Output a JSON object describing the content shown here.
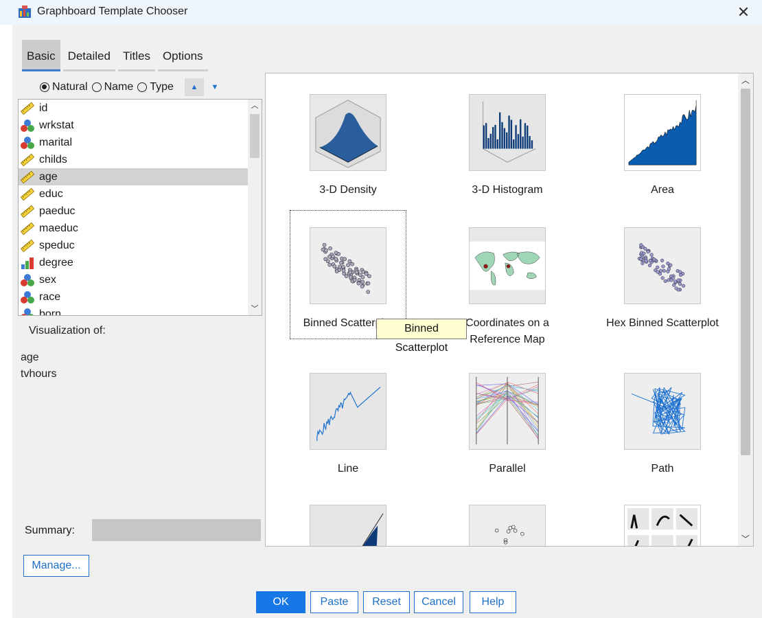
{
  "window": {
    "title": "Graphboard Template Chooser",
    "close_glyph": "✕",
    "icon": "graphboard-app-icon"
  },
  "tabs": [
    {
      "label": "Basic",
      "active": true
    },
    {
      "label": "Detailed",
      "active": false
    },
    {
      "label": "Titles",
      "active": false
    },
    {
      "label": "Options",
      "active": false
    }
  ],
  "sort": {
    "options": [
      {
        "label": "Natural",
        "selected": true
      },
      {
        "label": "Name",
        "selected": false
      },
      {
        "label": "Type",
        "selected": false
      }
    ],
    "up_glyph": "▲",
    "down_glyph": "▼"
  },
  "variables": [
    {
      "name": "id",
      "icon": "scale-ruler-icon",
      "selected": false
    },
    {
      "name": "wrkstat",
      "icon": "nominal-icon",
      "selected": false
    },
    {
      "name": "marital",
      "icon": "nominal-icon",
      "selected": false
    },
    {
      "name": "childs",
      "icon": "scale-ruler-icon",
      "selected": false
    },
    {
      "name": "age",
      "icon": "scale-ruler-icon",
      "selected": true
    },
    {
      "name": "educ",
      "icon": "scale-ruler-icon",
      "selected": false
    },
    {
      "name": "paeduc",
      "icon": "scale-ruler-icon",
      "selected": false
    },
    {
      "name": "maeduc",
      "icon": "scale-ruler-icon",
      "selected": false
    },
    {
      "name": "speduc",
      "icon": "scale-ruler-icon",
      "selected": false
    },
    {
      "name": "degree",
      "icon": "ordinal-icon",
      "selected": false
    },
    {
      "name": "sex",
      "icon": "nominal-icon",
      "selected": false
    },
    {
      "name": "race",
      "icon": "nominal-icon",
      "selected": false
    },
    {
      "name": "born",
      "icon": "nominal-icon",
      "selected": false
    }
  ],
  "visualization": {
    "label": "Visualization of:",
    "items": [
      "age",
      "tvhours"
    ]
  },
  "summary": {
    "label": "Summary:",
    "value": ""
  },
  "manage_label": "Manage...",
  "templates": [
    {
      "label": "3-D Density",
      "thumb": "3d-density"
    },
    {
      "label": "3-D Histogram",
      "thumb": "3d-histogram"
    },
    {
      "label": "Area",
      "thumb": "area"
    },
    {
      "label": "Binned Scatterplot",
      "thumb": "binned-scatterplot",
      "focused": true
    },
    {
      "label": "Coordinates on a Reference Map",
      "thumb": "reference-map"
    },
    {
      "label": "Hex Binned Scatterplot",
      "thumb": "hex-binned-scatterplot"
    },
    {
      "label": "Line",
      "thumb": "line"
    },
    {
      "label": "Parallel",
      "thumb": "parallel"
    },
    {
      "label": "Path",
      "thumb": "path"
    },
    {
      "label": "",
      "thumb": "ribbon"
    },
    {
      "label": "",
      "thumb": "scatter"
    },
    {
      "label": "",
      "thumb": "small-multiples"
    }
  ],
  "tooltip": "Binned Scatterplot",
  "buttons": {
    "ok": "OK",
    "paste": "Paste",
    "reset": "Reset",
    "cancel": "Cancel",
    "help": "Help"
  },
  "colors": {
    "accent": "#1877e6",
    "selection": "#d2d2d2",
    "tooltip_bg": "#ffffd2",
    "chart_fill": "#0a5cb0"
  }
}
